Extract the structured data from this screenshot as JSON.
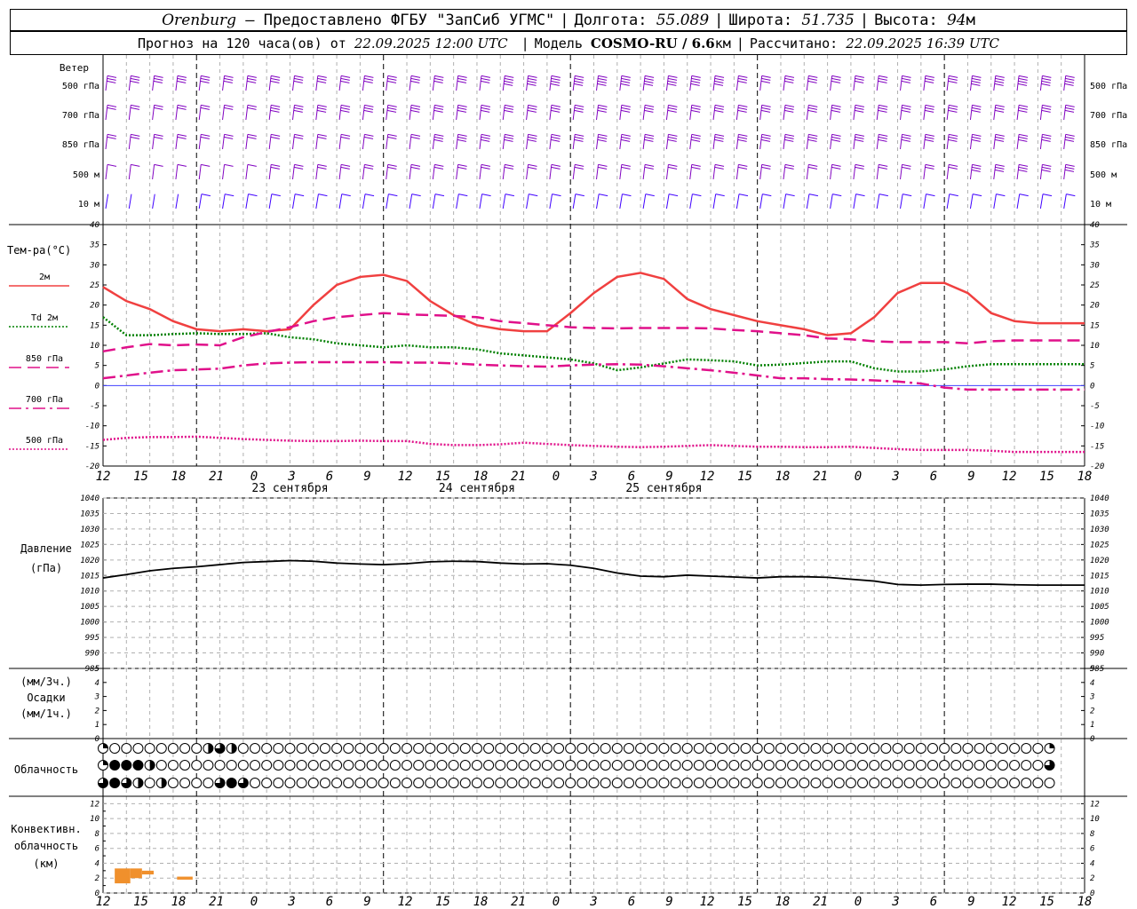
{
  "header": {
    "station": "Orenburg",
    "provider": "— Предоставлено ФГБУ \"ЗапСиб УГМС\"",
    "lon_label": "Долгота:",
    "lon_value": "55.089",
    "lat_label": "Широта:",
    "lat_value": "51.735",
    "alt_label": "Высота:",
    "alt_value": "94",
    "alt_unit": "м",
    "forecast_label": "Прогноз на 120 часа(ов) от",
    "forecast_start": "22.09.2025 12:00 UTC",
    "model_label": "Модель",
    "model_name": "COSMO-RU / 6.6",
    "model_unit": "км",
    "calc_label": "Рассчитано:",
    "calc_time": "22.09.2025 16:39 UTC"
  },
  "time_axis": {
    "hour_labels": [
      "12",
      "15",
      "18",
      "21",
      "0",
      "3",
      "6",
      "9",
      "12",
      "15",
      "18",
      "21",
      "0",
      "3",
      "6",
      "9",
      "12",
      "15",
      "18",
      "21",
      "0",
      "3",
      "6",
      "9",
      "12",
      "15",
      "18"
    ],
    "day_labels": [
      "23 сентября",
      "24 сентября",
      "25 сентября"
    ]
  },
  "wind_panel": {
    "title": "Ветер",
    "levels": [
      "500 гПа",
      "700 гПа",
      "850 гПа",
      "500 м",
      "10 м"
    ]
  },
  "chart_data": [
    {
      "type": "line",
      "title": "Тем-ра(°C)",
      "ylim": [
        -20,
        40
      ],
      "yticks": [
        "40",
        "35",
        "30",
        "25",
        "20",
        "15",
        "10",
        "5",
        "0",
        "-5",
        "-10",
        "-15",
        "-20"
      ],
      "x": [
        0,
        3,
        6,
        9,
        12,
        15,
        18,
        21,
        24,
        27,
        30,
        33,
        36,
        39,
        42,
        45,
        48,
        51,
        54,
        57,
        60,
        63,
        66,
        69,
        72,
        75,
        78,
        81,
        84,
        87,
        90,
        93,
        96,
        99,
        102,
        105,
        108,
        111,
        114,
        117,
        120,
        123,
        126
      ],
      "series": [
        {
          "name": "2м",
          "color": "#f04040",
          "style": "solid",
          "values": [
            24.5,
            21,
            19,
            16,
            14,
            13.5,
            14,
            13.5,
            14,
            20,
            25,
            27,
            27.5,
            26,
            21,
            17.5,
            15,
            14,
            13.5,
            13.5,
            18,
            23,
            27,
            28,
            26.5,
            21.5,
            19,
            17.5,
            16,
            15,
            14,
            12.5,
            13,
            17,
            23,
            25.5,
            25.5,
            23,
            18,
            16,
            15.5,
            15.5,
            15.5
          ]
        },
        {
          "name": "Td 2м",
          "color": "#008000",
          "style": "dot",
          "values": [
            17,
            12.5,
            12.5,
            12.8,
            13,
            12.8,
            12.8,
            13,
            12,
            11.5,
            10.5,
            10,
            9.5,
            10,
            9.5,
            9.5,
            9,
            8,
            7.5,
            7,
            6.5,
            5.5,
            3.8,
            4.5,
            5.5,
            6.5,
            6.3,
            6,
            5,
            5.2,
            5.6,
            6,
            6,
            4.3,
            3.5,
            3.5,
            4,
            4.8,
            5.3,
            5.3,
            5.3,
            5.3,
            5.3
          ]
        },
        {
          "name": "850 гПа",
          "color": "#e0108a",
          "style": "longdash",
          "values": [
            8.5,
            9.5,
            10.3,
            10,
            10.2,
            10,
            12,
            13.3,
            14.5,
            16,
            17,
            17.5,
            18,
            17.7,
            17.5,
            17.3,
            17,
            16,
            15.5,
            15,
            14.5,
            14.3,
            14.2,
            14.3,
            14.3,
            14.3,
            14.2,
            13.8,
            13.5,
            13,
            12.5,
            11.7,
            11.5,
            11,
            10.8,
            10.8,
            10.8,
            10.5,
            11,
            11.2,
            11.2,
            11.2,
            11.2
          ]
        },
        {
          "name": "700 гПа",
          "color": "#e0108a",
          "style": "dashdot",
          "values": [
            1.8,
            2.5,
            3.2,
            3.8,
            4,
            4.2,
            5,
            5.5,
            5.7,
            5.8,
            5.8,
            5.8,
            5.8,
            5.7,
            5.7,
            5.5,
            5.2,
            5,
            4.8,
            4.7,
            5,
            5.2,
            5.3,
            5.2,
            4.8,
            4.3,
            3.8,
            3.2,
            2.5,
            1.8,
            1.8,
            1.6,
            1.5,
            1.3,
            1,
            0.5,
            -0.5,
            -1,
            -1,
            -1,
            -1,
            -1,
            -1
          ]
        },
        {
          "name": "500 гПа",
          "color": "#e0108a",
          "style": "dot",
          "values": [
            -13.5,
            -13,
            -12.8,
            -12.8,
            -12.7,
            -13,
            -13.3,
            -13.5,
            -13.7,
            -13.8,
            -13.8,
            -13.7,
            -13.8,
            -13.8,
            -14.5,
            -14.8,
            -14.8,
            -14.6,
            -14.2,
            -14.5,
            -14.8,
            -15,
            -15.2,
            -15.3,
            -15.2,
            -15,
            -14.8,
            -15,
            -15.2,
            -15.2,
            -15.3,
            -15.3,
            -15.2,
            -15.5,
            -15.8,
            -16,
            -16,
            -16,
            -16.2,
            -16.5,
            -16.5,
            -16.5,
            -16.5
          ]
        }
      ]
    },
    {
      "type": "line",
      "title": "Давление",
      "ylabel": "(гПа)",
      "ylim": [
        985,
        1040
      ],
      "yticks": [
        "1040",
        "1035",
        "1030",
        "1025",
        "1020",
        "1015",
        "1010",
        "1005",
        "1000",
        "995",
        "990",
        "985"
      ],
      "x": [
        0,
        3,
        6,
        9,
        12,
        15,
        18,
        21,
        24,
        27,
        30,
        33,
        36,
        39,
        42,
        45,
        48,
        51,
        54,
        57,
        60,
        63,
        66,
        69,
        72,
        75,
        78,
        81,
        84,
        87,
        90,
        93,
        96,
        99,
        102,
        105,
        108,
        111,
        114,
        117,
        120,
        123,
        126
      ],
      "series": [
        {
          "name": "Давление",
          "color": "#000000",
          "values": [
            1014.2,
            1015.3,
            1016.5,
            1017.3,
            1017.8,
            1018.5,
            1019.2,
            1019.5,
            1019.8,
            1019.6,
            1019,
            1018.7,
            1018.5,
            1018.8,
            1019.4,
            1019.6,
            1019.5,
            1019,
            1018.7,
            1018.8,
            1018.3,
            1017.3,
            1015.8,
            1014.8,
            1014.6,
            1015.1,
            1014.8,
            1014.5,
            1014.2,
            1014.6,
            1014.6,
            1014.4,
            1013.8,
            1013.2,
            1012.1,
            1011.9,
            1012.1,
            1012.2,
            1012.2,
            1012.0,
            1011.9,
            1011.9,
            1011.9
          ]
        }
      ]
    },
    {
      "type": "bar",
      "title": "Осадки",
      "ylabel_top": "(мм/3ч.)",
      "ylabel_bottom": "(мм/1ч.)",
      "ylim": [
        0,
        5
      ],
      "yticks": [
        "5",
        "4",
        "3",
        "2",
        "1",
        "0"
      ],
      "values": []
    },
    {
      "type": "table",
      "title": "Облачность",
      "rows": [
        "1000000002320000000000000000000000000000000000000000000000000000000000000000000001",
        "1444200000000000000000000000000000000000000000000000000000000000000000000000000003",
        "3432020000343000000000000000000000000000000000000000000000000000000000000000000000"
      ],
      "legend": "0=clear,1=25%,2=50%,3=75%,4=overcast"
    },
    {
      "type": "bar",
      "title": "Конвективн. облачность",
      "ylabel": "(км)",
      "ylim": [
        0,
        13
      ],
      "yticks": [
        "12",
        "10",
        "8",
        "6",
        "4",
        "2",
        "0"
      ],
      "color": "#f0902c",
      "series": [
        {
          "x_start": 1.5,
          "x_end": 3.5,
          "base": 1.3,
          "top": 3.3
        },
        {
          "x_start": 3.5,
          "x_end": 5.0,
          "base": 2.0,
          "top": 3.3
        },
        {
          "x_start": 5.0,
          "x_end": 6.5,
          "base": 2.5,
          "top": 3.0
        },
        {
          "x_start": 9.5,
          "x_end": 11.5,
          "base": 1.8,
          "top": 2.2
        }
      ]
    }
  ]
}
